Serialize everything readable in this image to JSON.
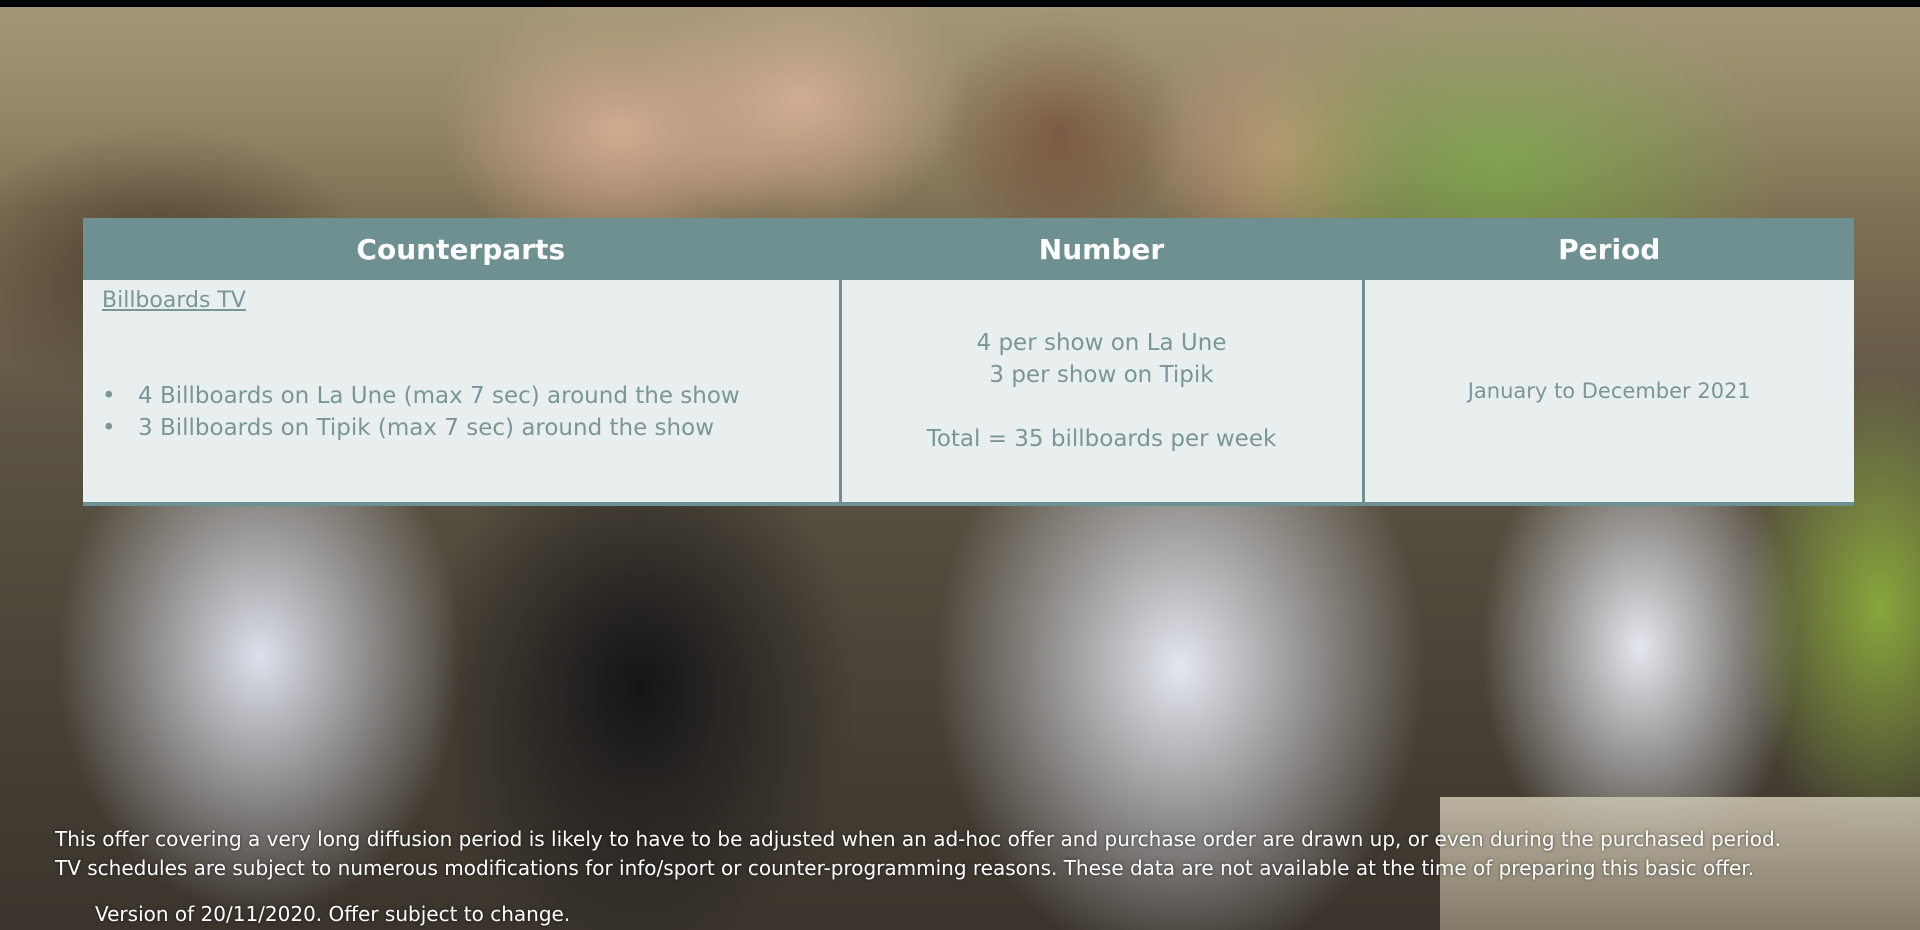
{
  "table": {
    "headers": {
      "counterparts": "Counterparts",
      "number": "Number",
      "period": "Period"
    },
    "counterparts": {
      "title": "Billboards TV",
      "items": [
        "4 Billboards on La Une (max 7 sec) around the show",
        "3 Billboards on Tipik (max 7 sec) around the show"
      ]
    },
    "number": {
      "line1": "4 per show on La Une",
      "line2": "3 per show on Tipik",
      "total": "Total = 35 billboards per week"
    },
    "period": {
      "value": "January to December 2021"
    }
  },
  "footer": {
    "line1": "This offer covering a very long diffusion period is likely to have to be adjusted when an ad-hoc offer and purchase order are drawn up, or even during the purchased period.",
    "line2": "TV schedules are subject to numerous modifications for info/sport or counter-programming reasons. These data are not available at the time of preparing this basic offer.",
    "version": "Version of 20/11/2020.  Offer subject to change."
  },
  "colors": {
    "header_bg": "#6e9090",
    "cell_bg": "#e9eeee",
    "cell_text": "#7a9797"
  }
}
